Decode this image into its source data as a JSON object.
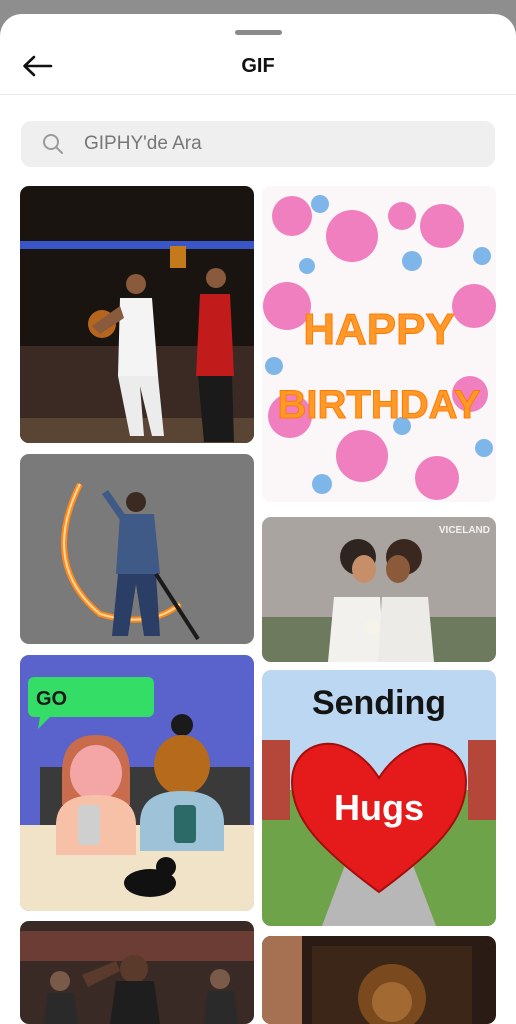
{
  "header": {
    "title": "GIF",
    "back_icon": "arrow-left-icon"
  },
  "search": {
    "placeholder": "GIPHY'de Ara",
    "value": "",
    "icon": "search-icon"
  },
  "gifs": {
    "birthday": {
      "line1": "HAPPY",
      "line2": "BIRTHDAY"
    },
    "chat": {
      "bubble": "GO"
    },
    "hugs": {
      "line1": "Sending",
      "line2": "Hugs"
    },
    "kiss": {
      "watermark": "VICELAND"
    }
  }
}
